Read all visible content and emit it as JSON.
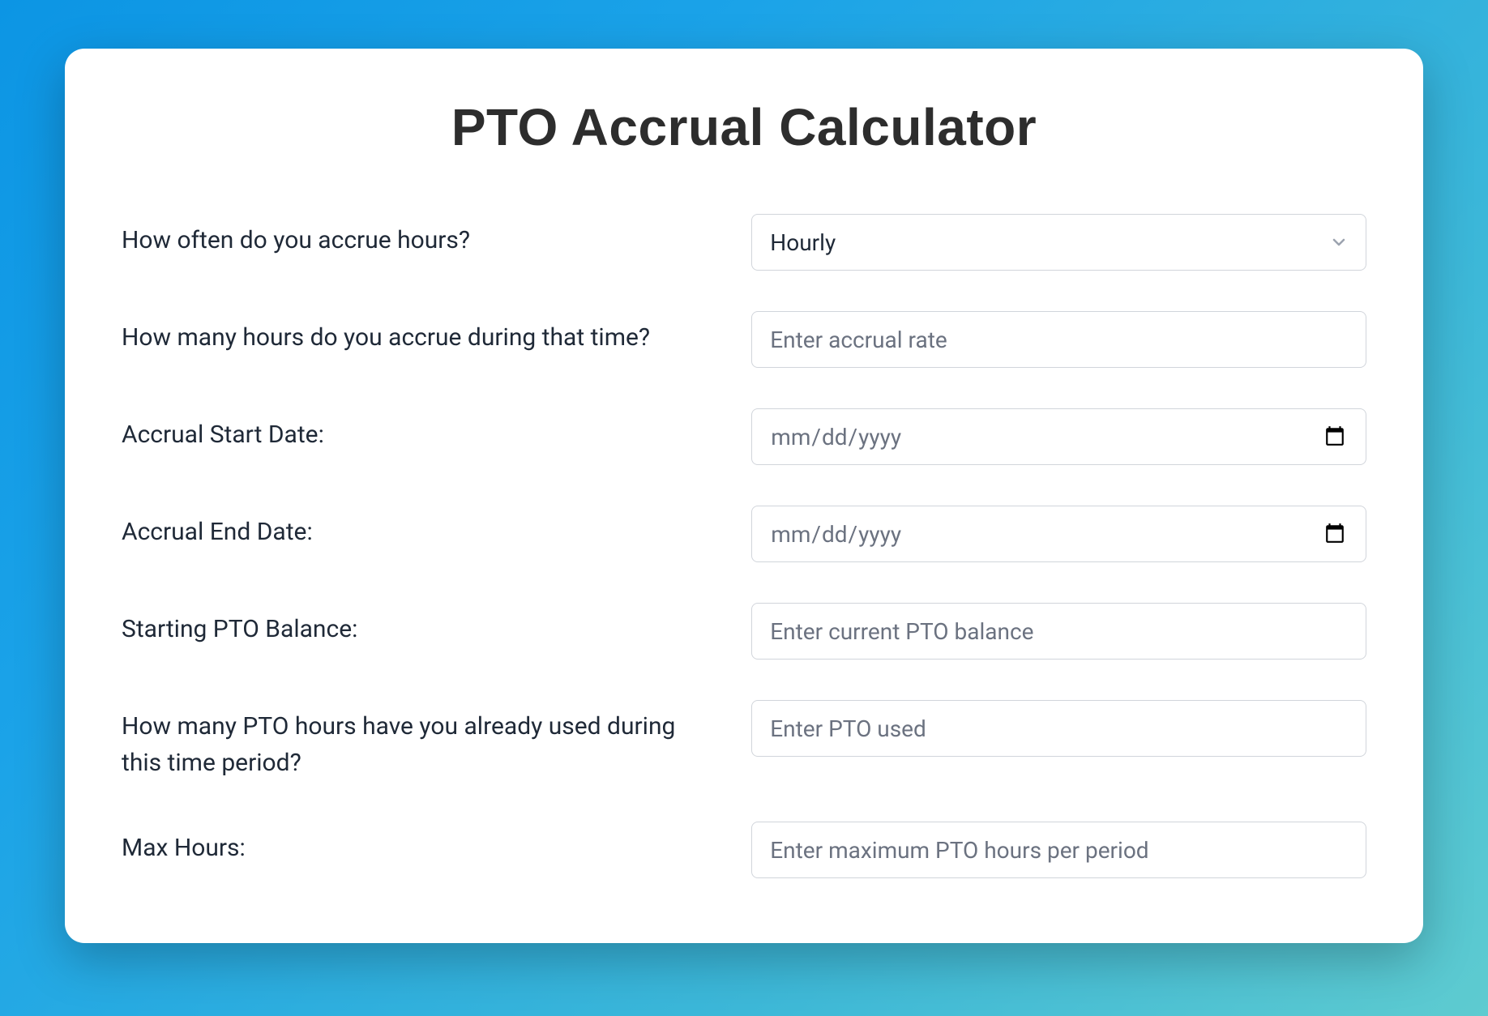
{
  "title": "PTO Accrual Calculator",
  "fields": {
    "frequency": {
      "label": "How often do you accrue hours?",
      "value": "Hourly"
    },
    "rate": {
      "label": "How many hours do you accrue during that time?",
      "placeholder": "Enter accrual rate"
    },
    "start_date": {
      "label": "Accrual Start Date:",
      "placeholder": "mm/dd/yyyy"
    },
    "end_date": {
      "label": "Accrual End Date:",
      "placeholder": "mm/dd/yyyy"
    },
    "starting_balance": {
      "label": "Starting PTO Balance:",
      "placeholder": "Enter current PTO balance"
    },
    "pto_used": {
      "label": "How many PTO hours have you already used during this time period?",
      "placeholder": "Enter PTO used"
    },
    "max_hours": {
      "label": "Max Hours:",
      "placeholder": "Enter maximum PTO hours per period"
    }
  }
}
